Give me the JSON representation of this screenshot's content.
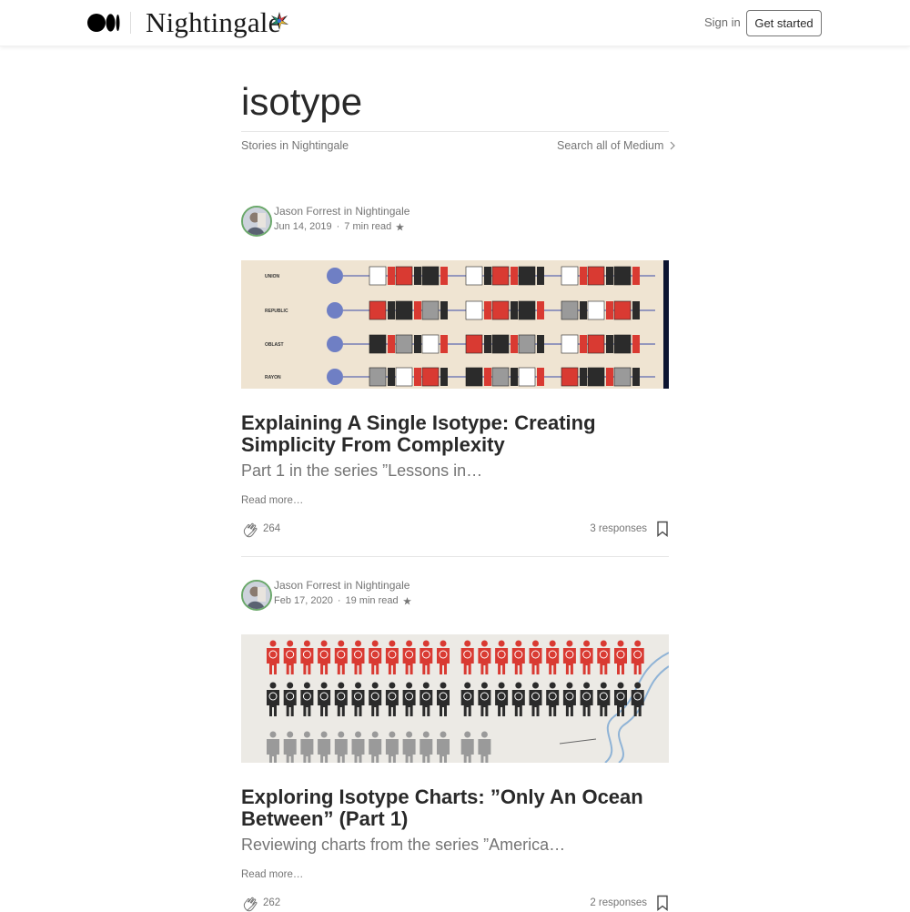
{
  "header": {
    "publication_name": "Nightingale",
    "sign_in_label": "Sign in",
    "get_started_label": "Get started"
  },
  "tag_page": {
    "title": "isotype",
    "stories_label": "Stories in Nightingale",
    "search_all_label": "Search all of Medium"
  },
  "posts": [
    {
      "author_line": "Jason Forrest in Nightingale",
      "date": "Jun 14, 2019",
      "read_time": "7 min read",
      "image_labels": [
        "UNION",
        "REPUBLIC",
        "OBLAST",
        "RAYON"
      ],
      "title": "Explaining A Single Isotype: Creating Simplicity From Complexity",
      "subtitle": "Part 1 in the series ”Lessons in…",
      "read_more": "Read more…",
      "claps": "264",
      "responses": "3 responses"
    },
    {
      "author_line": "Jason Forrest in Nightingale",
      "date": "Feb 17, 2020",
      "read_time": "19 min read",
      "title": "Exploring Isotype Charts: ”Only An Ocean Between” (Part 1)",
      "subtitle": "Reviewing charts from the series ”America…",
      "read_more": "Read more…",
      "claps": "262",
      "responses": "2 responses"
    }
  ],
  "colors": {
    "accent_red": "#d93a32",
    "text_dark": "#292929",
    "text_muted": "#757575"
  }
}
